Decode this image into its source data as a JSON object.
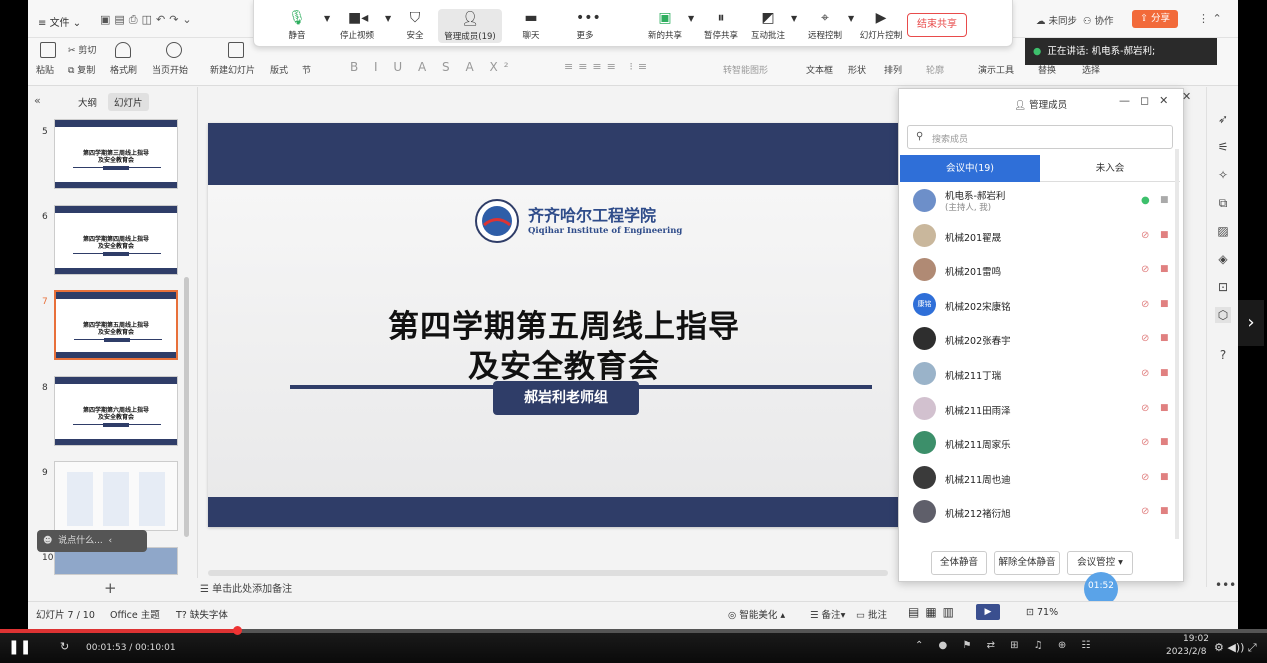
{
  "meetbar": {
    "buttons": [
      {
        "label": "静音",
        "icon": "mic-icon"
      },
      {
        "label": "停止视频",
        "icon": "video-icon"
      },
      {
        "label": "安全",
        "icon": "shield-icon"
      },
      {
        "label": "管理成员(19)",
        "icon": "members-icon"
      },
      {
        "label": "聊天",
        "icon": "chat-icon"
      },
      {
        "label": "更多",
        "icon": "more-icon"
      },
      {
        "label": "新的共享",
        "icon": "share-icon"
      },
      {
        "label": "暂停共享",
        "icon": "pause-icon"
      },
      {
        "label": "互动批注",
        "icon": "annotate-icon"
      },
      {
        "label": "远程控制",
        "icon": "remote-icon"
      },
      {
        "label": "幻灯片控制",
        "icon": "slideshow-icon"
      }
    ],
    "end_share": "结束共享"
  },
  "topbar": {
    "file_menu": "文件",
    "unsynced": "未同步",
    "collab": "协作",
    "share": "分享",
    "speaking": "正在讲话: 机电系-郝岩利;"
  },
  "ribbon": {
    "paste": "粘贴",
    "cut": "剪切",
    "copy": "复制",
    "format_painter": "格式刷",
    "from_current": "当页开始",
    "new_slide": "新建幻灯片",
    "layout": "版式",
    "section": "节",
    "smart_shape": "转智能图形",
    "textbox": "文本框",
    "shape": "形状",
    "arrange": "排列",
    "outline": "轮廓",
    "presenter": "演示工具",
    "replace": "替换",
    "select": "选择"
  },
  "leftpanel": {
    "tab_outline": "大纲",
    "tab_slides": "幻灯片",
    "slides": [
      {
        "num": "5",
        "title": "第四学期第三周线上指导\n及安全教育会"
      },
      {
        "num": "6",
        "title": "第四学期第四周线上指导\n及安全教育会"
      },
      {
        "num": "7",
        "title": "第四学期第五周线上指导\n及安全教育会"
      },
      {
        "num": "8",
        "title": "第四学期第六周线上指导\n及安全教育会"
      },
      {
        "num": "9",
        "title": ""
      },
      {
        "num": "10",
        "title": ""
      }
    ],
    "comment_placeholder": "说点什么..."
  },
  "slide": {
    "school_cn": "齐齐哈尔工程学院",
    "school_en": "Qiqihar Institute of Engineering",
    "title_line1": "第四学期第五周线上指导",
    "title_line2": "及安全教育会",
    "presenter": "郝岩利老师组"
  },
  "notes_placeholder": "单击此处添加备注",
  "members": {
    "title": "管理成员",
    "search_placeholder": "搜索成员",
    "tab_in": "会议中(19)",
    "tab_out": "未入会",
    "list": [
      {
        "name": "机电系-郝岩利",
        "sub": "(主持人, 我)",
        "color": "#6d8fc9"
      },
      {
        "name": "机械201翟晟",
        "color": "#c9b79c"
      },
      {
        "name": "机械201雷鸣",
        "color": "#b08a74"
      },
      {
        "name": "机械202宋康铭",
        "color": "#2f6fd8",
        "avatar_text": "康铭"
      },
      {
        "name": "机械202张春宇",
        "color": "#2e2e2e"
      },
      {
        "name": "机械211丁瑞",
        "color": "#9ab3c9"
      },
      {
        "name": "机械211田雨泽",
        "color": "#d2c1cf"
      },
      {
        "name": "机械211周家乐",
        "color": "#3c8f6a"
      },
      {
        "name": "机械211周也迪",
        "color": "#3a3a3a"
      },
      {
        "name": "机械212褚衍旭",
        "color": "#5f5f6a"
      }
    ],
    "mute_all": "全体静音",
    "unmute_all": "解除全体静音",
    "meeting_control": "会议管控",
    "timer": "01:52"
  },
  "statusbar": {
    "slide_info": "幻灯片 7 / 10",
    "theme": "Office 主题",
    "missing_font": "缺失字体",
    "smart_beauty": "智能美化",
    "notes": "备注",
    "comments": "批注",
    "zoom": "71%"
  },
  "player": {
    "time": "00:01:53 / 00:10:01",
    "progress": 0.188,
    "clock": "19:02",
    "date": "2023/2/8"
  }
}
